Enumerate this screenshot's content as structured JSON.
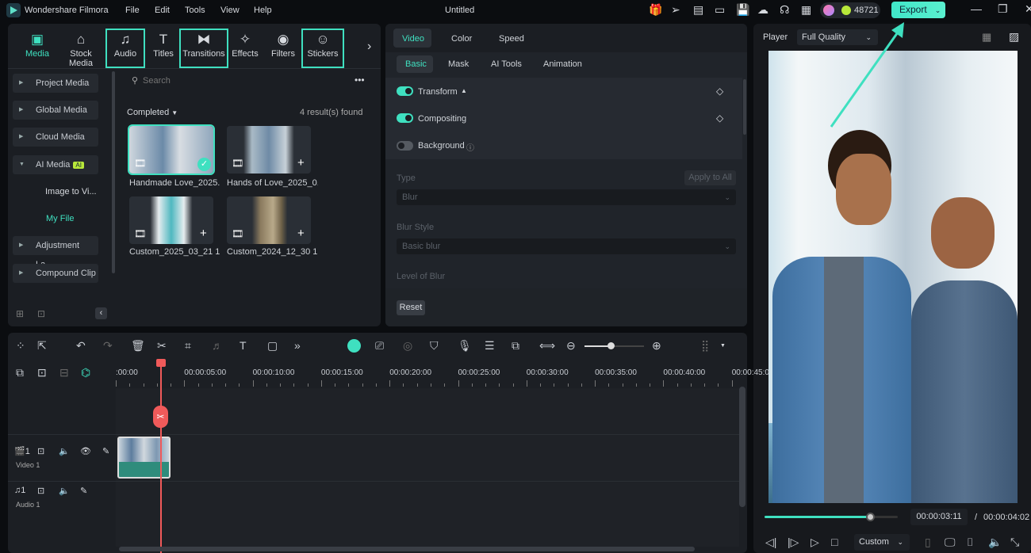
{
  "app": {
    "title": "Wondershare Filmora",
    "doc_title": "Untitled",
    "credits": "48721",
    "export_label": "Export",
    "menu": [
      "File",
      "Edit",
      "Tools",
      "View",
      "Help"
    ],
    "accent": "#3fe0c0"
  },
  "toolbar": {
    "items": [
      {
        "label": "Media",
        "icon": "media-icon",
        "active": true
      },
      {
        "label": "Stock Media",
        "icon": "store-icon"
      },
      {
        "label": "Audio",
        "icon": "music-note-icon",
        "highlighted": true
      },
      {
        "label": "Titles",
        "icon": "text-icon"
      },
      {
        "label": "Transitions",
        "icon": "transition-icon",
        "highlighted": true
      },
      {
        "label": "Effects",
        "icon": "effects-icon"
      },
      {
        "label": "Filters",
        "icon": "filter-icon"
      },
      {
        "label": "Stickers",
        "icon": "sticker-icon",
        "highlighted": true
      }
    ]
  },
  "sidebar": {
    "items": [
      "Project Media",
      "Global Media",
      "Cloud Media",
      "AI Media",
      "Image to Vi...",
      "My File",
      "Adjustment La...",
      "Compound Clip"
    ],
    "ai_badge": "AI"
  },
  "media": {
    "search_placeholder": "Search",
    "filter": "Completed",
    "results": "4 result(s) found",
    "items": [
      {
        "name": "Handmade Love_2025...",
        "selected": true
      },
      {
        "name": "Hands of Love_2025_0..."
      },
      {
        "name": "Custom_2025_03_21 1..."
      },
      {
        "name": "Custom_2024_12_30 1..."
      }
    ]
  },
  "properties": {
    "tabs": [
      "Video",
      "Color",
      "Speed"
    ],
    "active_tab": "Video",
    "subtabs": [
      "Basic",
      "Mask",
      "AI Tools",
      "Animation"
    ],
    "active_subtab": "Basic",
    "rows": [
      {
        "label": "Transform",
        "on": true
      },
      {
        "label": "Compositing",
        "on": true
      },
      {
        "label": "Background",
        "on": false
      }
    ],
    "type_label": "Type",
    "apply_all": "Apply to All",
    "type_value": "Blur",
    "blur_style_label": "Blur Style",
    "blur_style_value": "Basic blur",
    "level_label": "Level of Blur",
    "reset": "Reset"
  },
  "player": {
    "label": "Player",
    "quality": "Full Quality",
    "current_time": "00:00:03:11",
    "separator": "/",
    "total_time": "00:00:04:02",
    "progress": 0.79,
    "zoom_option": "Custom"
  },
  "timeline": {
    "ticks": [
      ":00:00",
      "00:00:05:00",
      "00:00:10:00",
      "00:00:15:00",
      "00:00:20:00",
      "00:00:25:00",
      "00:00:30:00",
      "00:00:35:00",
      "00:00:40:00",
      "00:00:45:0"
    ],
    "tracks": [
      {
        "label": "Video 1",
        "num": "1"
      },
      {
        "label": "Audio 1",
        "num": "1"
      }
    ]
  }
}
